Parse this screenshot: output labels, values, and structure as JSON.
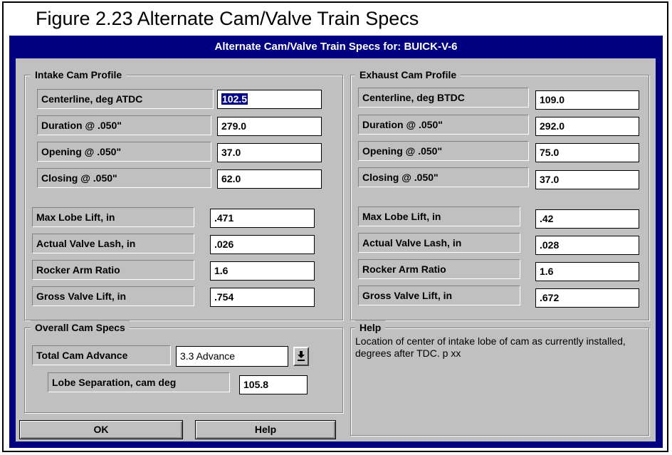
{
  "figure_title": "Figure 2.23  Alternate Cam/Valve Train Specs",
  "dialog_title": "Alternate Cam/Valve Train Specs for: BUICK-V-6",
  "intake": {
    "group_title": "Intake Cam Profile",
    "centerline_label": "Centerline, deg ATDC",
    "centerline_value": "102.5",
    "duration_label": "Duration @ .050\"",
    "duration_value": "279.0",
    "opening_label": "Opening @ .050\"",
    "opening_value": "37.0",
    "closing_label": "Closing @ .050\"",
    "closing_value": "62.0",
    "max_lobe_label": "Max Lobe Lift, in",
    "max_lobe_value": ".471",
    "lash_label": "Actual Valve Lash, in",
    "lash_value": ".026",
    "rocker_label": "Rocker Arm Ratio",
    "rocker_value": "1.6",
    "gross_label": "Gross Valve Lift, in",
    "gross_value": ".754"
  },
  "exhaust": {
    "group_title": "Exhaust Cam Profile",
    "centerline_label": "Centerline, deg BTDC",
    "centerline_value": "109.0",
    "duration_label": "Duration @ .050\"",
    "duration_value": "292.0",
    "opening_label": "Opening @ .050\"",
    "opening_value": "75.0",
    "closing_label": "Closing @ .050\"",
    "closing_value": "37.0",
    "max_lobe_label": "Max Lobe Lift, in",
    "max_lobe_value": ".42",
    "lash_label": "Actual Valve Lash, in",
    "lash_value": ".028",
    "rocker_label": "Rocker Arm Ratio",
    "rocker_value": "1.6",
    "gross_label": "Gross Valve Lift, in",
    "gross_value": ".672"
  },
  "overall": {
    "group_title": "Overall Cam Specs",
    "advance_label": "Total Cam Advance",
    "advance_value": "3.3 Advance",
    "dropdown_icon": "arrow-down-underscore-icon",
    "lsa_label": "Lobe Separation, cam deg",
    "lsa_value": "105.8"
  },
  "help": {
    "group_title": "Help",
    "text": "Location of center of intake lobe of cam as currently installed, degrees after TDC.  p xx"
  },
  "buttons": {
    "ok": "OK",
    "help": "Help"
  },
  "colors": {
    "title_bar": "#000080",
    "face": "#c0c0c0",
    "selection": "#000080"
  }
}
